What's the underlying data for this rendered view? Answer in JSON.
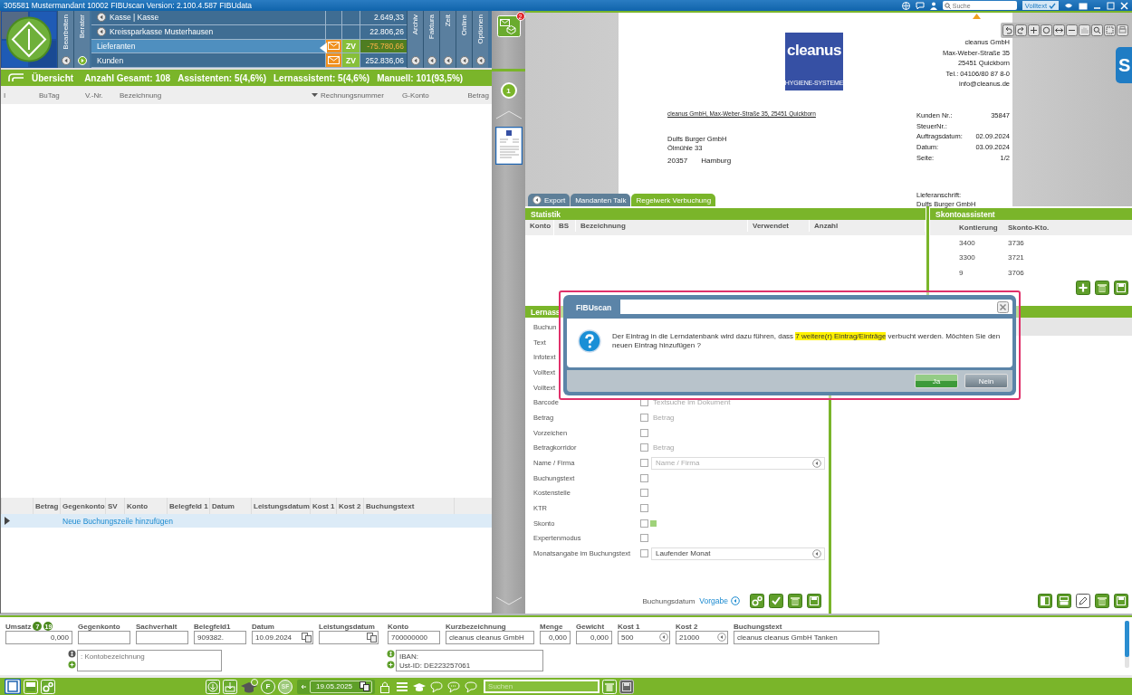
{
  "title_bar": {
    "title": "305581 Mustermandant 10002 FIBUscan Version: 2.100.4.587 FIBUdata",
    "search": {
      "placeholder": "Suche"
    },
    "fulltext": {
      "label": "Volltext",
      "checked": true
    }
  },
  "left_tabs": [
    {
      "label": "Bearbeiten",
      "active": false
    },
    {
      "label": "Berater",
      "active": true
    }
  ],
  "accounts": [
    {
      "kind": "bank",
      "name": "Kasse | Kasse",
      "amount": "2.649,33",
      "selected": false,
      "negative": false
    },
    {
      "kind": "bank",
      "name": "Kreissparkasse Musterhausen",
      "amount": "22.806,26",
      "selected": false,
      "negative": false
    },
    {
      "kind": "ledger",
      "name": "Lieferanten",
      "badge": "ZV",
      "amount": "-75.780,66",
      "selected": true,
      "negative": true
    },
    {
      "kind": "ledger",
      "name": "Kunden",
      "badge": "ZV",
      "amount": "252.836,06",
      "selected": false,
      "negative": false
    }
  ],
  "right_tabs": [
    {
      "label": "Archiv"
    },
    {
      "label": "Faktura"
    },
    {
      "label": "Zeit"
    },
    {
      "label": "Online"
    },
    {
      "label": "Optionen"
    }
  ],
  "summary": {
    "title": "Übersicht",
    "stats": [
      "Anzahl Gesamt: 108",
      "Assistenten: 5(4,6%)",
      "Lernassistent: 5(4,6%)",
      "Manuell: 101(93,5%)"
    ]
  },
  "document_list": {
    "columns": [
      {
        "label": "I",
        "sorted": false
      },
      {
        "label": "BuTag",
        "sorted": false
      },
      {
        "label": "V.-Nr.",
        "sorted": false
      },
      {
        "label": "Bezeichnung",
        "sorted": true
      },
      {
        "label": "Rechnungsnummer",
        "sorted": false
      },
      {
        "label": "G-Konto",
        "sorted": false
      },
      {
        "label": "Betrag",
        "sorted": false
      }
    ]
  },
  "bookings": {
    "columns": [
      "Betrag",
      "Gegenkonto",
      "SV",
      "Konto",
      "Belegfeld 1",
      "Datum",
      "Leistungsdatum",
      "Kost 1",
      "Kost 2",
      "Buchungstext"
    ],
    "new_row": "Neue Buchungszeile hinzufügen"
  },
  "inbox": {
    "badge": "2"
  },
  "pages": {
    "current": "1"
  },
  "document": {
    "logo": {
      "name": "cleanus",
      "tagline": "HYGIENE-SYSTEME"
    },
    "sender": [
      "cleanus GmbH",
      "Max-Weber-Straße 35",
      "25451 Quickborn",
      "Tel.: 04106/80 87 8-0",
      "info@cleanus.de"
    ],
    "return_address": "cleanus GmbH, Max-Weber-Straße 35, 25451 Quickborn",
    "recipient": [
      "Dulfs Burger GmbH",
      "Ölmühle 33"
    ],
    "recipient_city": {
      "zip": "20357",
      "city": "Hamburg"
    },
    "meta": [
      {
        "label": "Kunden Nr.:",
        "value": "35847"
      },
      {
        "label": "SteuerNr.:"
      },
      {
        "label": "Auftragsdatum:",
        "value": "02.09.2024"
      },
      {
        "label": "Datum:",
        "value": "03.09.2024"
      },
      {
        "label": "Seite:",
        "value": "1/2"
      }
    ],
    "delivery": [
      "Lieferanschrift:",
      "Dulfs Burger GmbH"
    ]
  },
  "viewer_tabs": [
    {
      "label": "Export",
      "selected": false
    },
    {
      "label": "Mandanten Talk",
      "selected": false
    },
    {
      "label": "Regelwerk Verbuchung",
      "selected": true
    }
  ],
  "side_tab": {
    "label": "S"
  },
  "statistik": {
    "title": "Statistik",
    "columns": [
      "Konto",
      "BS",
      "Bezeichnung",
      "Verwendet",
      "Anzahl"
    ]
  },
  "skonto": {
    "title": "Skontoassistent",
    "columns": [
      "Kontierung",
      "Skonto-Kto."
    ],
    "rows": [
      [
        "3400",
        "3736"
      ],
      [
        "3300",
        "3721"
      ],
      [
        "9",
        "3706"
      ]
    ]
  },
  "lernassistent": {
    "title": "Lernass",
    "rows": [
      {
        "kind": "label",
        "label": "Buchun"
      },
      {
        "kind": "label",
        "label": "Text"
      },
      {
        "kind": "label",
        "label": "Infotext"
      },
      {
        "kind": "label",
        "label": "Volltext"
      },
      {
        "kind": "label",
        "label": "Volltext"
      },
      {
        "kind": "hint",
        "label": "Barcode",
        "checked": false,
        "hint": "Textsuche im Dokument"
      },
      {
        "kind": "hint",
        "label": "Betrag",
        "checked": false,
        "hint": "Betrag"
      },
      {
        "kind": "plain",
        "label": "Vorzeichen",
        "checked": false
      },
      {
        "kind": "hint",
        "label": "Betragkorridor",
        "checked": false,
        "hint": "Betrag"
      },
      {
        "kind": "select",
        "label": "Name / Firma",
        "checked": false,
        "placeholder": "Name / Firma"
      },
      {
        "kind": "plain",
        "label": "Buchungstext",
        "checked": false
      },
      {
        "kind": "plain",
        "label": "Kostenstelle",
        "checked": false
      },
      {
        "kind": "plain",
        "label": "KTR",
        "checked": false
      },
      {
        "kind": "swatch",
        "label": "Skonto",
        "checked": false
      },
      {
        "kind": "plain",
        "label": "Expertenmodus",
        "checked": false
      },
      {
        "kind": "select",
        "label": "Monatsangabe im Buchungstext",
        "checked": false,
        "value": "Laufender Monat"
      }
    ],
    "footer": {
      "label": "Buchungsdatum",
      "value": "Vorgabe"
    }
  },
  "dialog": {
    "title": "FIBUscan",
    "message": {
      "before": "Der Eintrag in die Lerndatenbank wird dazu führen, dass ",
      "highlight": "7 weitere(r) Eintrag/Einträge",
      "after": " verbucht werden. Möchten Sie den neuen Eintrag hinzufügen ?"
    },
    "buttons": [
      {
        "label": "Ja",
        "primary": true
      },
      {
        "label": "Nein",
        "primary": false
      }
    ]
  },
  "form": {
    "fields": [
      {
        "label": "Umsatz",
        "kind": "number",
        "value": "0,000",
        "tax_badges": [
          "7",
          "19"
        ]
      },
      {
        "label": "Gegenkonto",
        "kind": "text"
      },
      {
        "label": "Sachverhalt",
        "kind": "text"
      },
      {
        "label": "Belegfeld1",
        "kind": "text",
        "value": "909382."
      },
      {
        "label": "Datum",
        "kind": "date",
        "value": "10.09.2024"
      },
      {
        "label": "Leistungsdatum",
        "kind": "date"
      },
      {
        "label": "Konto",
        "kind": "text",
        "value": "700000000"
      },
      {
        "label": "Kurzbezeichnung",
        "kind": "text",
        "value": "cleanus cleanus GmbH"
      },
      {
        "label": "Menge",
        "kind": "number",
        "value": "0,000"
      },
      {
        "label": "Gewicht",
        "kind": "number",
        "value": "0,000"
      },
      {
        "label": "Kost 1",
        "kind": "select",
        "value": "500"
      },
      {
        "label": "Kost 2",
        "kind": "select",
        "value": "21000"
      },
      {
        "label": "Buchungstext",
        "kind": "text",
        "value": "cleanus cleanus GmbH Tanken"
      }
    ],
    "account_note": {
      "placeholder": ": Kontobezeichnung"
    },
    "partner_note": {
      "lines": [
        "IBAN:",
        "Ust-ID: DE223257061"
      ]
    }
  },
  "toolbar": {
    "letter_buttons": [
      "F",
      "SF"
    ],
    "date": "19.05.2025",
    "search": {
      "placeholder": "Suchen"
    }
  }
}
